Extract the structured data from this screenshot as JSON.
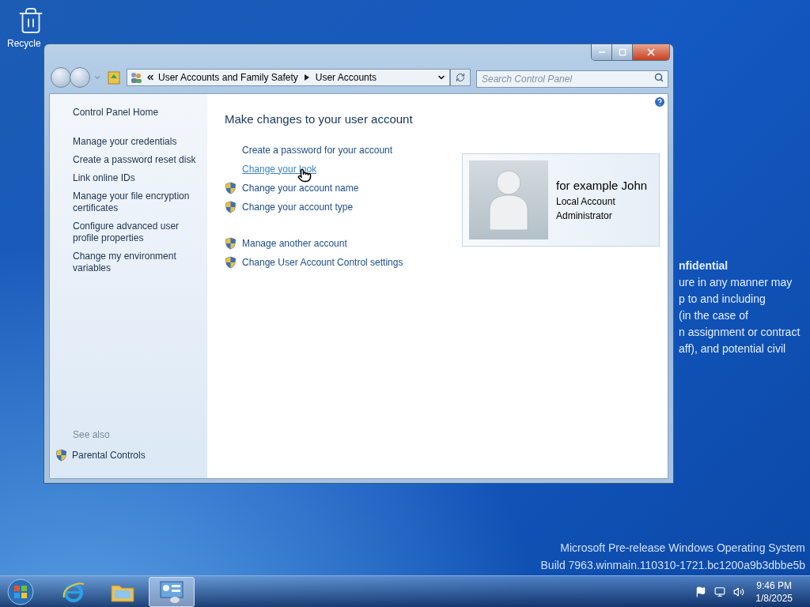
{
  "desktop": {
    "icons": [
      {
        "label": "Recycle"
      }
    ],
    "notice_lines": [
      {
        "text": "nfidential",
        "bold": true
      },
      {
        "text": "ure in any manner may",
        "bold": false
      },
      {
        "text": "p to and including",
        "bold": false
      },
      {
        "text": "(in the case of",
        "bold": false
      },
      {
        "text": "n assignment or contract",
        "bold": false
      },
      {
        "text": "aff), and potential civil",
        "bold": false
      }
    ],
    "build_info": [
      "Microsoft Pre-release Windows Operating System",
      "Build 7963.winmain.110310-1721.bc1200a9b3dbbe5b"
    ]
  },
  "window": {
    "breadcrumb": [
      "User Accounts and Family Safety",
      "User Accounts"
    ],
    "search": {
      "placeholder": "Search Control Panel"
    },
    "sidebar": {
      "home": "Control Panel Home",
      "tasks": [
        "Manage your credentials",
        "Create a password reset disk",
        "Link online IDs",
        "Manage your file encryption certificates",
        "Configure advanced user profile properties",
        "Change my environment variables"
      ],
      "see_also_heading": "See also",
      "see_also": [
        {
          "label": "Parental Controls",
          "shield": true
        }
      ]
    },
    "main": {
      "heading": "Make changes to your user account",
      "link_groups": [
        [
          {
            "label": "Create a password for your account",
            "shield": false,
            "hovered": false
          },
          {
            "label": "Change your look",
            "shield": false,
            "hovered": true
          },
          {
            "label": "Change your account name",
            "shield": true,
            "hovered": false
          },
          {
            "label": "Change your account type",
            "shield": true,
            "hovered": false
          }
        ],
        [
          {
            "label": "Manage another account",
            "shield": true,
            "hovered": false
          },
          {
            "label": "Change User Account Control settings",
            "shield": true,
            "hovered": false
          }
        ]
      ],
      "account": {
        "name": "for example John",
        "type": "Local Account",
        "role": "Administrator"
      }
    }
  },
  "taskbar": {
    "apps": [
      {
        "kind": "browser",
        "active": false
      },
      {
        "kind": "explorer",
        "active": false
      },
      {
        "kind": "control-panel",
        "active": true
      }
    ],
    "clock": {
      "time": "9:46 PM",
      "date": "1/8/2025"
    }
  }
}
